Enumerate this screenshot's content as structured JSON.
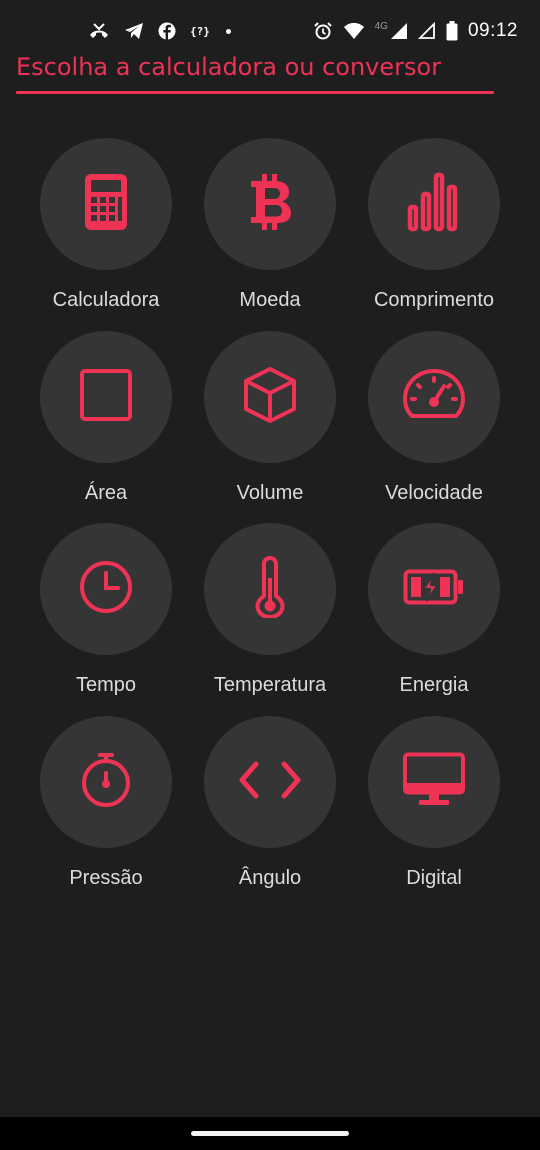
{
  "status_bar": {
    "icons_left": [
      "missed-call-icon",
      "telegram-icon",
      "facebook-icon",
      "json-icon",
      "dot-icon"
    ],
    "json_glyph": "{?}",
    "icons_right": [
      "alarm-icon",
      "wifi-icon",
      "signal-icon",
      "signal-empty-icon",
      "battery-icon"
    ],
    "network_label": "4G",
    "time": "09:12"
  },
  "header": {
    "title": "Escolha a calculadora ou conversor",
    "accent_color": "#ee3355"
  },
  "tiles": [
    {
      "label": "Calculadora",
      "icon": "calculator-icon"
    },
    {
      "label": "Moeda",
      "icon": "bitcoin-icon"
    },
    {
      "label": "Comprimento",
      "icon": "bar-chart-icon"
    },
    {
      "label": "Área",
      "icon": "square-icon"
    },
    {
      "label": "Volume",
      "icon": "cube-icon"
    },
    {
      "label": "Velocidade",
      "icon": "speedometer-icon"
    },
    {
      "label": "Tempo",
      "icon": "clock-icon"
    },
    {
      "label": "Temperatura",
      "icon": "thermometer-icon"
    },
    {
      "label": "Energia",
      "icon": "battery-charging-icon"
    },
    {
      "label": "Pressão",
      "icon": "stopwatch-icon"
    },
    {
      "label": "Ângulo",
      "icon": "angle-brackets-icon"
    },
    {
      "label": "Digital",
      "icon": "monitor-icon"
    }
  ],
  "colors": {
    "background": "#1e1e1e",
    "tile": "#353535",
    "accent": "#ee3355",
    "text": "#dcdcdc"
  }
}
